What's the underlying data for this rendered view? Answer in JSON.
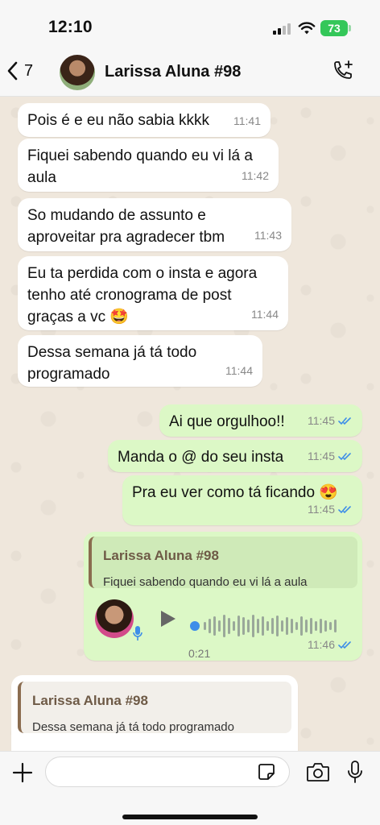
{
  "status": {
    "time": "12:10",
    "battery": "73"
  },
  "header": {
    "back_count": "7",
    "contact_name": "Larissa Aluna #98"
  },
  "messages": [
    {
      "text": "Pois é e eu não sabia kkkk",
      "time": "11:41"
    },
    {
      "text": "Fiquei sabendo quando eu vi lá a aula",
      "time": "11:42"
    },
    {
      "text": "So mudando de assunto e aproveitar pra agradecer tbm",
      "time": "11:43"
    },
    {
      "text": "Eu ta perdida com o insta e agora tenho até cronograma de post graças a vc 🤩",
      "time": "11:44"
    },
    {
      "text": "Dessa semana já tá todo programado",
      "time": "11:44"
    },
    {
      "text": "Ai que orgulhoo!!",
      "time": "11:45"
    },
    {
      "text": "Manda o @ do seu insta",
      "time": "11:45"
    },
    {
      "text": "Pra eu ver como tá ficando 😍",
      "time": "11:45"
    }
  ],
  "voice_reply": {
    "quote_name": "Larissa Aluna #98",
    "quote_text": "Fiquei sabendo quando eu vi lá a aula",
    "duration": "0:21",
    "time": "11:46"
  },
  "incoming_reply": {
    "quote_name": "Larissa Aluna #98",
    "quote_text": "Dessa semana já tá todo programado"
  },
  "input": {
    "placeholder": ""
  },
  "colors": {
    "outgoing": "#dcf8c6",
    "incoming": "#ffffff",
    "read_ticks": "#3e8ee8",
    "battery": "#34c759"
  }
}
